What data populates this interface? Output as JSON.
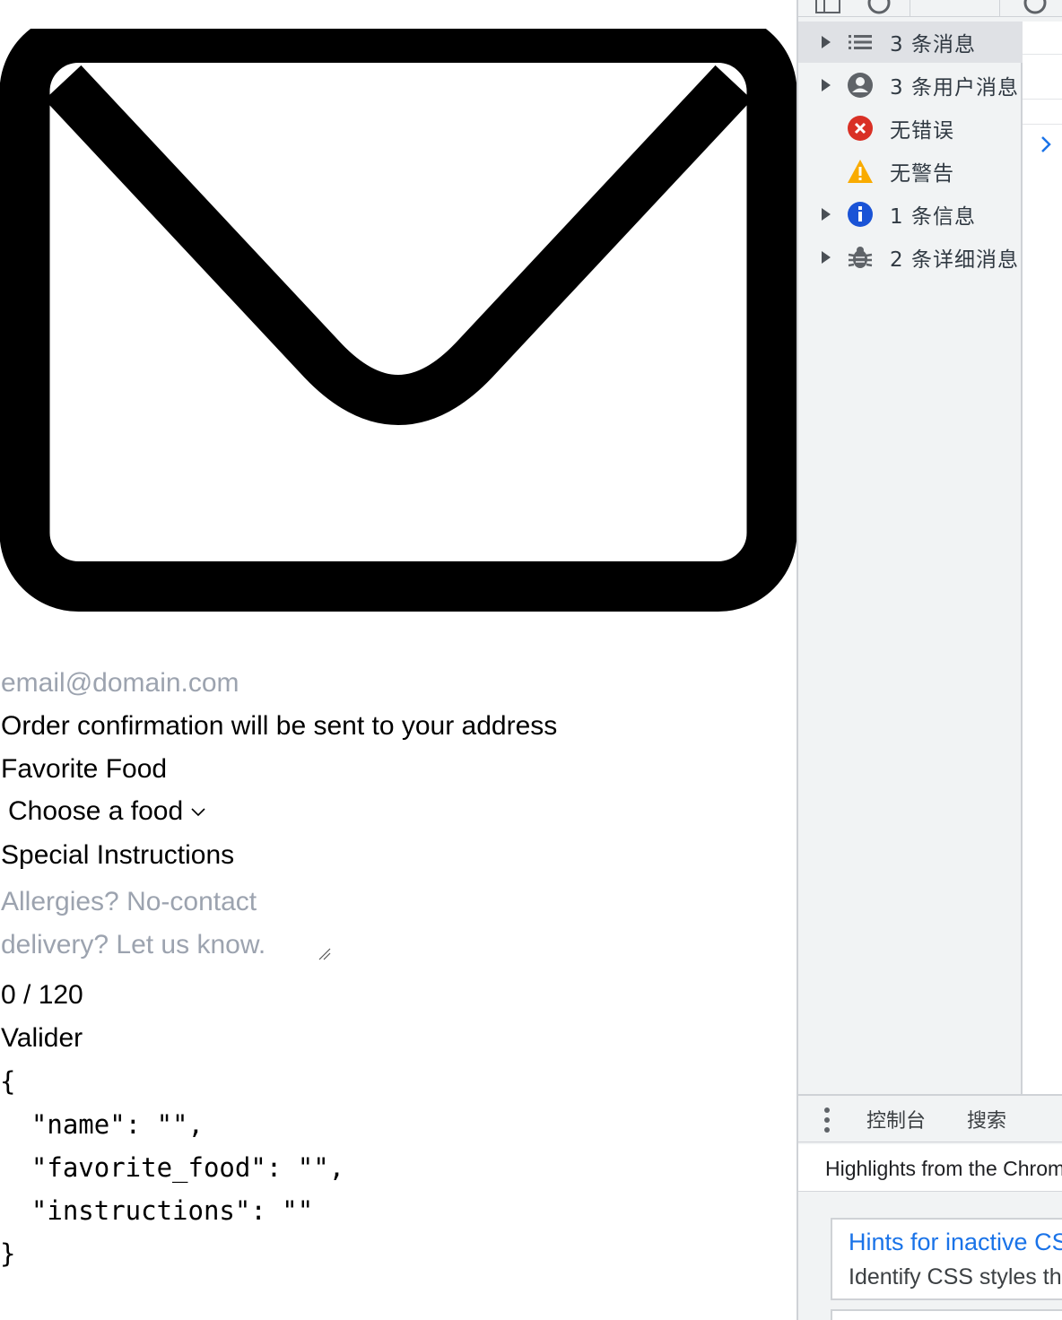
{
  "form": {
    "email_placeholder": "email@domain.com",
    "email_hint": "Order confirmation will be sent to your address",
    "food_label": "Favorite Food",
    "food_select_value": "Choose a food",
    "instructions_label": "Special Instructions",
    "instructions_placeholder": "Allergies? No-contact delivery? Let us know.",
    "char_count": "0 / 120",
    "submit_label": "Valider",
    "json_output": "{\n  \"name\": \"\",\n  \"favorite_food\": \"\",\n  \"instructions\": \"\"\n}"
  },
  "devtools": {
    "sidebar": {
      "items": [
        {
          "label": "3 条消息",
          "icon": "list-icon",
          "expandable": true,
          "selected": true
        },
        {
          "label": "3 条用户消息",
          "icon": "user-icon",
          "expandable": true,
          "selected": false
        },
        {
          "label": "无错误",
          "icon": "error-icon",
          "expandable": false,
          "selected": false
        },
        {
          "label": "无警告",
          "icon": "warning-icon",
          "expandable": false,
          "selected": false
        },
        {
          "label": "1 条信息",
          "icon": "info-icon",
          "expandable": true,
          "selected": false
        },
        {
          "label": "2 条详细消息",
          "icon": "bug-icon",
          "expandable": true,
          "selected": false
        }
      ]
    },
    "drawer_tabs": [
      "控制台",
      "搜索"
    ],
    "whats_new": {
      "header": "Highlights from the Chrome",
      "card_title": "Hints for inactive CSS",
      "card_desc": "Identify CSS styles that"
    },
    "colors": {
      "error": "#d93025",
      "warning": "#f9ab00",
      "info": "#1a53d6",
      "link": "#1a73e8"
    }
  }
}
